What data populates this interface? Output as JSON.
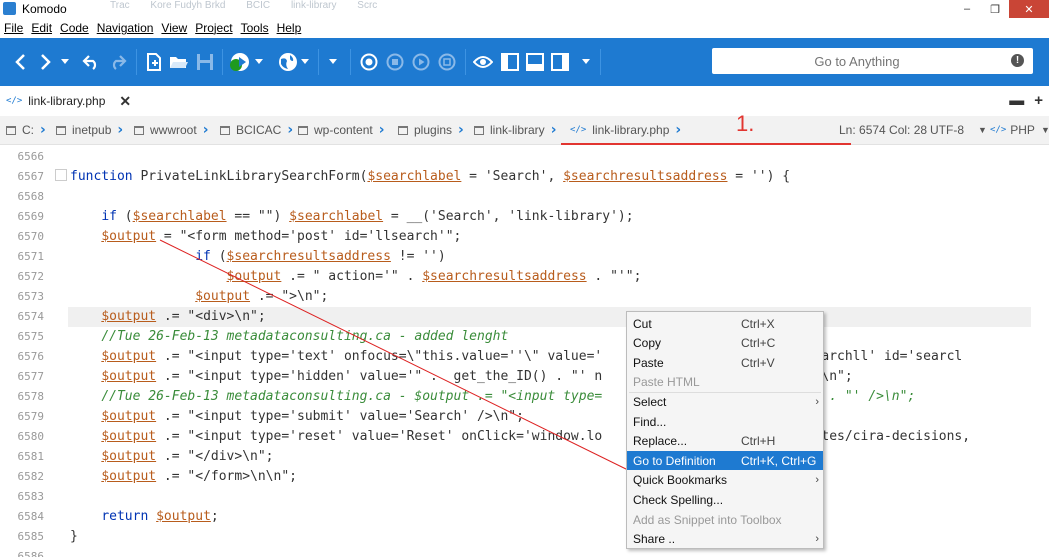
{
  "window": {
    "title": "Komodo",
    "ghost_tabs": [
      "Trac",
      "Kore Fudyh Brkd",
      "BCIC",
      "link-library",
      "Scrc"
    ]
  },
  "menu": [
    "File",
    "Edit",
    "Code",
    "Navigation",
    "View",
    "Project",
    "Tools",
    "Help"
  ],
  "goto": {
    "placeholder": "Go to Anything",
    "icon": "alert-icon"
  },
  "tab": {
    "label": "link-library.php",
    "icon": "php-file-icon"
  },
  "breadcrumbs": [
    "C:",
    "inetpub",
    "wwwroot",
    "BCICAC",
    "wp-content",
    "plugins",
    "link-library",
    "link-library.php"
  ],
  "status": {
    "position": "Ln: 6574 Col: 28",
    "encoding": "UTF-8",
    "language": "PHP"
  },
  "annotation": "1.",
  "editor": {
    "lines": [
      {
        "n": "6566",
        "html": ""
      },
      {
        "n": "6567",
        "html": "<span class='kw'>function</span> PrivateLinkLibrarySearchForm(<span class='var'>$searchlabel</span> = 'Search', <span class='var'>$searchresultsaddress</span> = '') {"
      },
      {
        "n": "6568",
        "html": ""
      },
      {
        "n": "6569",
        "html": "    <span class='kw'>if</span> (<span class='var'>$searchlabel</span> == \"\") <span class='var'>$searchlabel</span> = __('Search', 'link-library');"
      },
      {
        "n": "6570",
        "html": "    <span class='var'>$output</span> = \"&lt;form method='post' id='llsearch'\";"
      },
      {
        "n": "6571",
        "html": "                <span class='kw'>if</span> (<span class='var'>$searchresultsaddress</span> != '')"
      },
      {
        "n": "6572",
        "html": "                    <span class='var'>$output</span> .= \" action='\" . <span class='var'>$searchresultsaddress</span> . \"'\";"
      },
      {
        "n": "6573",
        "html": "                <span class='var'>$output</span> .= \"&gt;\\n\";"
      },
      {
        "n": "6574",
        "html": "    <span class='var'>$output</span> .= \"&lt;div&gt;\\n\";"
      },
      {
        "n": "6575",
        "html": "    <span class='cmt'>//Tue 26-Feb-13 metadataconsulting.ca - added lenght</span>"
      },
      {
        "n": "6576",
        "html": "    <span class='var'>$output</span> .= \"&lt;input type='text' onfocus=\\\"this.value=''\\\" value='                    name='searchll' id='searcl"
      },
      {
        "n": "6577",
        "html": "    <span class='var'>$output</span> .= \"&lt;input type='hidden' value='\" .  get_the_ID() . \"' n                       d' /&gt;\\n\";"
      },
      {
        "n": "6578",
        "html": "    <span class='cmt'>//Tue 26-Feb-13 metadataconsulting.ca - $output .= \"&lt;input type=                    rchlabel . \"' /&gt;\\n\";</span>"
      },
      {
        "n": "6579",
        "html": "    <span class='var'>$output</span> .= \"&lt;input type='submit' value='Search' /&gt;\\n\";"
      },
      {
        "n": "6580",
        "html": "    <span class='var'>$output</span> .= \"&lt;input type='reset' value='Reset' onClick='window.lo                    me-disputes/cira-decisions,"
      },
      {
        "n": "6581",
        "html": "    <span class='var'>$output</span> .= \"&lt;/div&gt;\\n\";"
      },
      {
        "n": "6582",
        "html": "    <span class='var'>$output</span> .= \"&lt;/form&gt;\\n\\n\";"
      },
      {
        "n": "6583",
        "html": ""
      },
      {
        "n": "6584",
        "html": "    <span class='kw'>return</span> <span class='var'>$output</span>;"
      },
      {
        "n": "6585",
        "html": "}"
      },
      {
        "n": "6586",
        "html": ""
      }
    ]
  },
  "context_menu": [
    {
      "label": "Cut",
      "key": "Ctrl+X"
    },
    {
      "label": "Copy",
      "key": "Ctrl+C"
    },
    {
      "label": "Paste",
      "key": "Ctrl+V"
    },
    {
      "label": "Paste HTML",
      "key": "",
      "disabled": true
    },
    {
      "sep": true
    },
    {
      "label": "Select",
      "key": "",
      "sub": true
    },
    {
      "label": "Find...",
      "key": ""
    },
    {
      "label": "Replace...",
      "key": "Ctrl+H"
    },
    {
      "sep": true
    },
    {
      "label": "Go to Definition",
      "key": "Ctrl+K, Ctrl+G",
      "selected": true
    },
    {
      "label": "Quick Bookmarks",
      "key": "",
      "sub": true
    },
    {
      "label": "Check Spelling...",
      "key": ""
    },
    {
      "label": "Add as Snippet into Toolbox",
      "key": "",
      "disabled": true
    },
    {
      "label": "Share ..",
      "key": "",
      "sub": true
    }
  ],
  "colors": {
    "accent": "#1e7ad1",
    "annotation": "#e23530",
    "menu_selected": "#1e7ad1"
  }
}
